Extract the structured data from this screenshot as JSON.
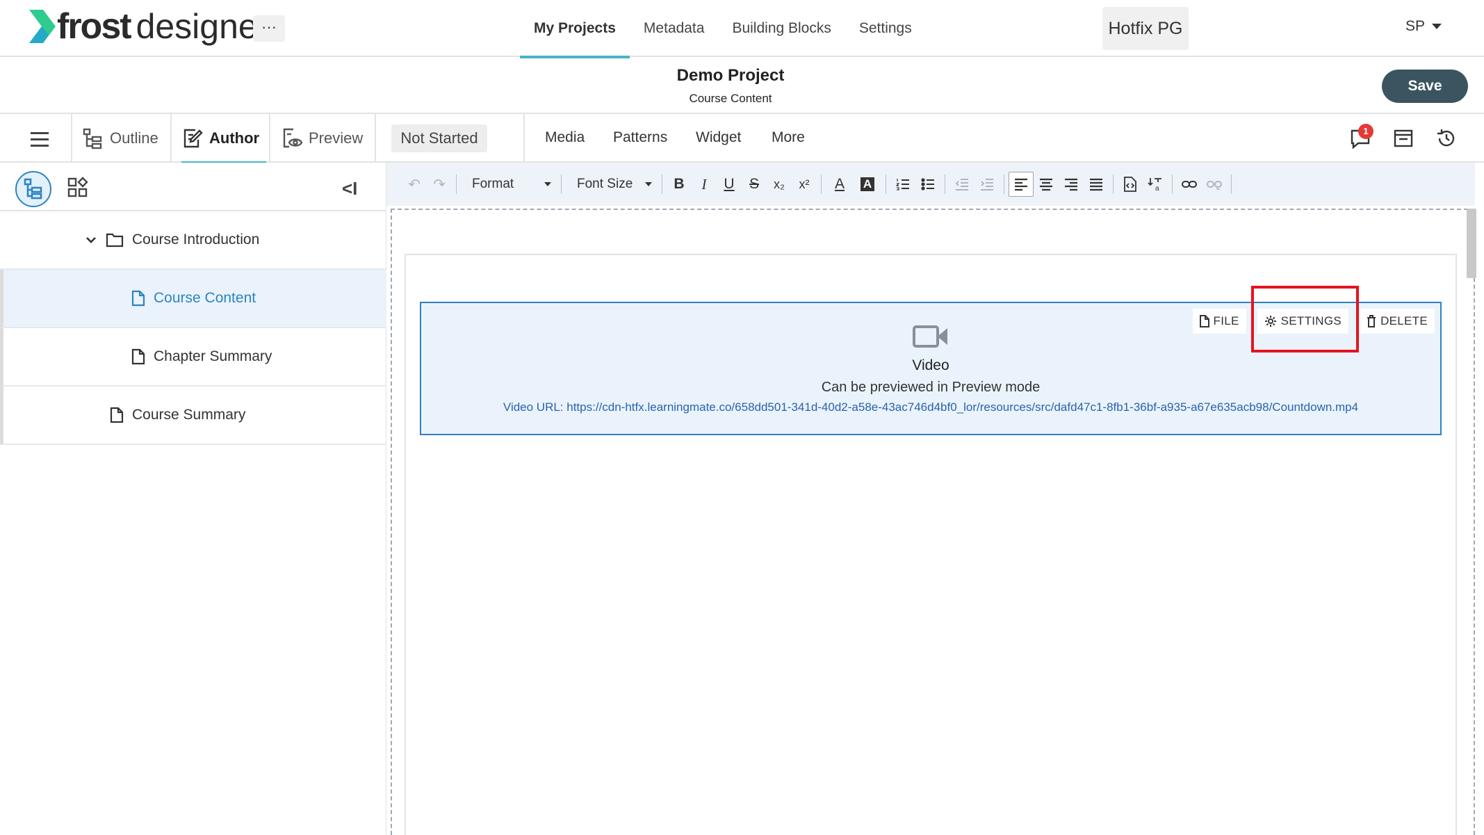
{
  "app": {
    "logo_frost": "frost",
    "logo_designer": "designer",
    "more_label": "···"
  },
  "nav": {
    "items": [
      {
        "label": "My Projects",
        "active": true
      },
      {
        "label": "Metadata",
        "active": false
      },
      {
        "label": "Building Blocks",
        "active": false
      },
      {
        "label": "Settings",
        "active": false
      }
    ],
    "environment": "Hotfix PG",
    "user_initials": "SP"
  },
  "titlebar": {
    "project_title": "Demo Project",
    "page_title": "Course Content",
    "save_label": "Save"
  },
  "modebar": {
    "tabs": [
      {
        "label": "Outline",
        "icon": "outline-icon"
      },
      {
        "label": "Author",
        "icon": "author-icon",
        "active": true
      },
      {
        "label": "Preview",
        "icon": "preview-icon"
      }
    ],
    "status": "Not Started",
    "tools": [
      "Media",
      "Patterns",
      "Widget",
      "More"
    ],
    "notification_count": "1"
  },
  "sidebar": {
    "collapse_label": "<I",
    "tree": [
      {
        "label": "Course Introduction",
        "type": "folder",
        "expanded": true
      },
      {
        "label": "Course Content",
        "type": "page",
        "selected": true
      },
      {
        "label": "Chapter Summary",
        "type": "page"
      },
      {
        "label": "Course Summary",
        "type": "page"
      }
    ]
  },
  "editor_toolbar": {
    "format_label": "Format",
    "font_size_label": "Font Size",
    "bold": "B",
    "italic": "I",
    "underline": "U",
    "strike": "S",
    "subscript": "x₂",
    "superscript": "x²",
    "text_color": "A",
    "bg_color": "A"
  },
  "video_block": {
    "actions": [
      {
        "label": "FILE",
        "icon": "file-icon"
      },
      {
        "label": "SETTINGS",
        "icon": "gear-icon"
      },
      {
        "label": "DELETE",
        "icon": "trash-icon"
      }
    ],
    "title": "Video",
    "note": "Can be previewed in Preview mode",
    "url_text": "Video URL: https://cdn-htfx.learningmate.co/658dd501-341d-40d2-a58e-43ac746d4bf0_lor/resources/src/dafd47c1-8fb1-36bf-a935-a67e635acb98/Countdown.mp4"
  },
  "colors": {
    "accent": "#47b5c8",
    "primary_blue": "#2e7fc2",
    "save_button": "#3a5560",
    "highlight": "#e5141e",
    "badge": "#e53935"
  }
}
